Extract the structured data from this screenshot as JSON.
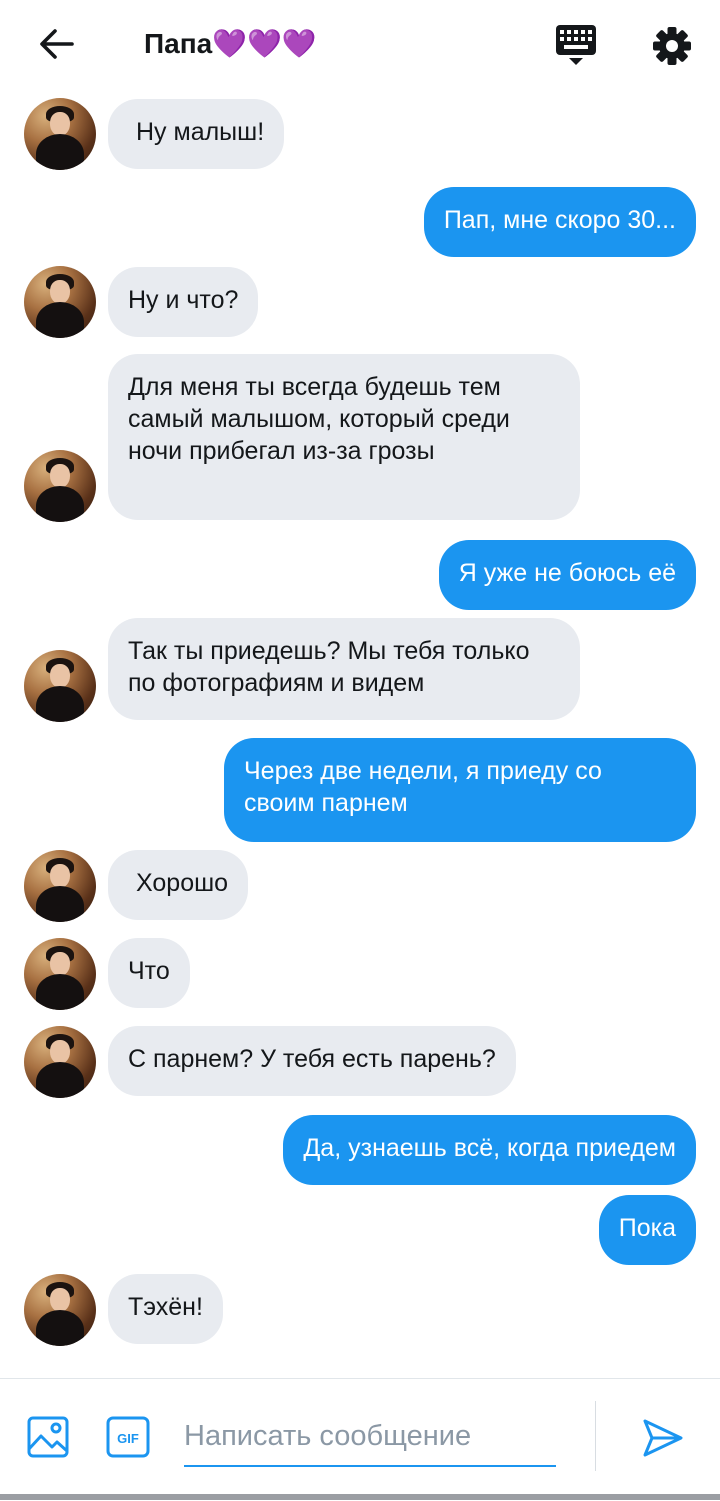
{
  "header": {
    "title": "Папа💜💜💜",
    "back_icon": "arrow-left-icon",
    "keyboard_icon": "keyboard-icon",
    "settings_icon": "gear-icon"
  },
  "messages": [
    {
      "side": "in",
      "text": "Ну малыш!"
    },
    {
      "side": "out",
      "text": "Пап, мне скоро 30..."
    },
    {
      "side": "in",
      "text": "Ну и что?"
    },
    {
      "side": "in",
      "text": "Для меня ты всегда будешь тем самый малышом, который среди ночи прибегал из-за грозы"
    },
    {
      "side": "out",
      "text": "Я уже не боюсь её"
    },
    {
      "side": "in",
      "text": "Так ты приедешь? Мы тебя только по фотографиям и видем"
    },
    {
      "side": "out",
      "text": "Через две недели, я приеду со своим парнем"
    },
    {
      "side": "in",
      "text": "Хорошо"
    },
    {
      "side": "in",
      "text": "Что"
    },
    {
      "side": "in",
      "text": "С парнем? У тебя есть парень?"
    },
    {
      "side": "out",
      "text": "Да, узнаешь всё, когда приедем"
    },
    {
      "side": "out",
      "text": "Пока"
    },
    {
      "side": "in",
      "text": "Тэхён!"
    }
  ],
  "composer": {
    "placeholder": "Написать сообщение",
    "gif_label": "GIF",
    "image_icon": "image-icon",
    "send_icon": "send-icon"
  },
  "colors": {
    "outgoing_bubble": "#1b95f0",
    "incoming_bubble": "#e8ebf0",
    "accent": "#1b95f0"
  }
}
